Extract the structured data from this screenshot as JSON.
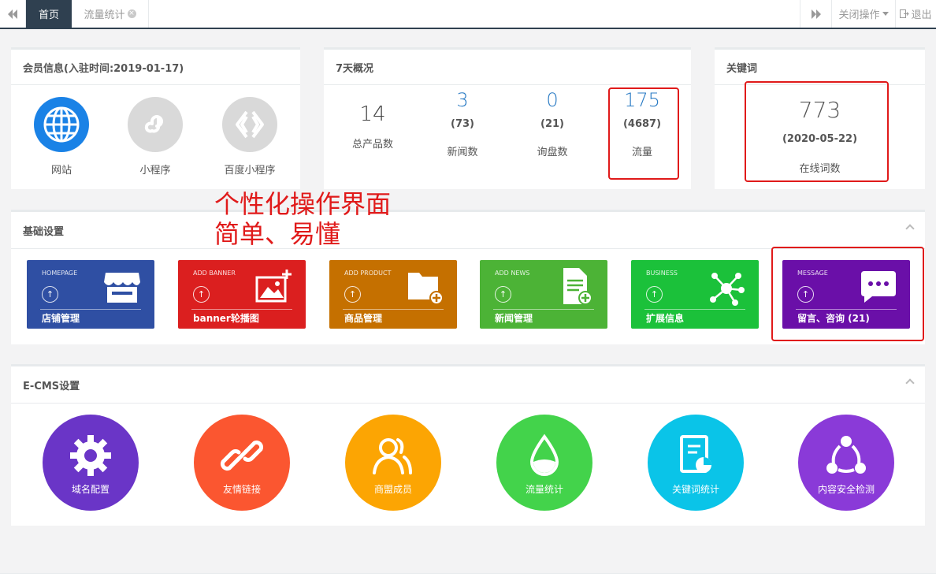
{
  "topbar": {
    "home_tab": "首页",
    "flow_tab": "流量统计",
    "close_ops": "关闭操作",
    "logout": "退出"
  },
  "member": {
    "title": "会员信息(入驻时间:2019-01-17)",
    "items": [
      {
        "label": "网站",
        "color": "#1e88e5"
      },
      {
        "label": "小程序",
        "color": "#d8d8d8"
      },
      {
        "label": "百度小程序",
        "color": "#d8d8d8"
      }
    ]
  },
  "overview": {
    "title": "7天概况",
    "stats": [
      {
        "value": "14",
        "sub": "",
        "label": "总产品数"
      },
      {
        "value": "3",
        "sub": "(73)",
        "label": "新闻数"
      },
      {
        "value": "0",
        "sub": "(21)",
        "label": "询盘数"
      },
      {
        "value": "175",
        "sub": "(4687)",
        "label": "流量"
      }
    ]
  },
  "keywords": {
    "title": "关键词",
    "value": "773",
    "date": "(2020-05-22)",
    "label": "在线词数"
  },
  "overlay": {
    "line1": "个性化操作界面",
    "line2": "简单、易懂"
  },
  "basic": {
    "title": "基础设置",
    "tiles": [
      {
        "en": "HOMEPAGE",
        "label": "店铺管理",
        "color": "#2f4fa3",
        "icon": "store-icon"
      },
      {
        "en": "ADD BANNER",
        "label": "banner轮播图",
        "color": "#db1f1f",
        "icon": "image-add-icon"
      },
      {
        "en": "ADD PRODUCT",
        "label": "商品管理",
        "color": "#c57000",
        "icon": "folder-add-icon"
      },
      {
        "en": "ADD NEWS",
        "label": "新闻管理",
        "color": "#4cb336",
        "icon": "document-add-icon"
      },
      {
        "en": "BUSINESS",
        "label": "扩展信息",
        "color": "#1bc13a",
        "icon": "network-icon"
      },
      {
        "en": "MESSAGE",
        "label": "留言、咨询 (21)",
        "color": "#6a0fa8",
        "icon": "chat-bubble-icon"
      }
    ]
  },
  "ecms": {
    "title": "E-CMS设置",
    "items": [
      {
        "label": "域名配置",
        "color": "#6a35c7",
        "icon": "gear-icon"
      },
      {
        "label": "友情链接",
        "color": "#fb5630",
        "icon": "link-icon"
      },
      {
        "label": "商盟成员",
        "color": "#fca503",
        "icon": "members-icon"
      },
      {
        "label": "流量统计",
        "color": "#43d34b",
        "icon": "drop-icon"
      },
      {
        "label": "关键词统计",
        "color": "#0ac4e8",
        "icon": "report-icon"
      },
      {
        "label": "内容安全检测",
        "color": "#8a3ad8",
        "icon": "share-network-icon"
      }
    ]
  }
}
